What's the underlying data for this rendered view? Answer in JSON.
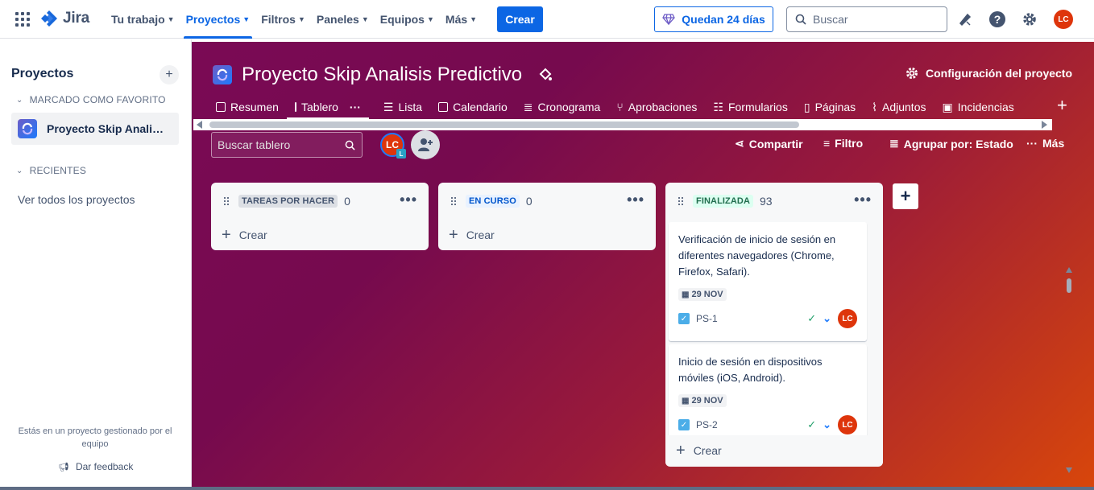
{
  "topnav": {
    "logo": "Jira",
    "menu": [
      {
        "label": "Tu trabajo",
        "active": false
      },
      {
        "label": "Proyectos",
        "active": true
      },
      {
        "label": "Filtros",
        "active": false
      },
      {
        "label": "Paneles",
        "active": false
      },
      {
        "label": "Equipos",
        "active": false
      },
      {
        "label": "Más",
        "active": false
      }
    ],
    "create_label": "Crear",
    "trial_label": "Quedan 24 días",
    "search_placeholder": "Buscar",
    "user_initials": "LC"
  },
  "sidebar": {
    "title": "Proyectos",
    "favorites_label": "MARCADO COMO FAVORITO",
    "project_name": "Proyecto Skip Analisis Predictivo",
    "recent_label": "RECIENTES",
    "view_all": "Ver todos los proyectos",
    "footer_text": "Estás en un proyecto gestionado por el equipo",
    "feedback": "Dar feedback"
  },
  "project": {
    "title": "Proyecto Skip Analisis Predictivo",
    "config_label": "Configuración del proyecto",
    "tabs": [
      {
        "label": "Resumen",
        "icon": "summary-icon"
      },
      {
        "label": "Tablero",
        "icon": "board-icon"
      },
      {
        "label": "Lista",
        "icon": "list-icon"
      },
      {
        "label": "Calendario",
        "icon": "calendar-icon"
      },
      {
        "label": "Cronograma",
        "icon": "timeline-icon"
      },
      {
        "label": "Aprobaciones",
        "icon": "approvals-icon"
      },
      {
        "label": "Formularios",
        "icon": "forms-icon"
      },
      {
        "label": "Páginas",
        "icon": "pages-icon"
      },
      {
        "label": "Adjuntos",
        "icon": "attachments-icon"
      },
      {
        "label": "Incidencias",
        "icon": "issues-icon"
      }
    ]
  },
  "board": {
    "search_placeholder": "Buscar tablero",
    "avatar_initials": "LC",
    "avatar_badge": "L",
    "share": "Compartir",
    "filter": "Filtro",
    "group_by": "Agrupar por: Estado",
    "more": "Más",
    "create_label": "Crear",
    "columns": [
      {
        "name": "TAREAS POR HACER",
        "count": "0"
      },
      {
        "name": "EN CURSO",
        "count": "0"
      },
      {
        "name": "FINALIZADA",
        "count": "93"
      }
    ],
    "cards": [
      {
        "title": "Verificación de inicio de sesión en diferentes navegadores (Chrome, Firefox, Safari).",
        "date": "29 NOV",
        "key": "PS-1",
        "assignee": "LC"
      },
      {
        "title": "Inicio de sesión en dispositivos móviles (iOS, Android).",
        "date": "29 NOV",
        "key": "PS-2",
        "assignee": "LC"
      }
    ]
  },
  "colors": {
    "brand_blue": "#0c66e4",
    "avatar_red": "#de350b",
    "done_green": "#216e4e"
  }
}
